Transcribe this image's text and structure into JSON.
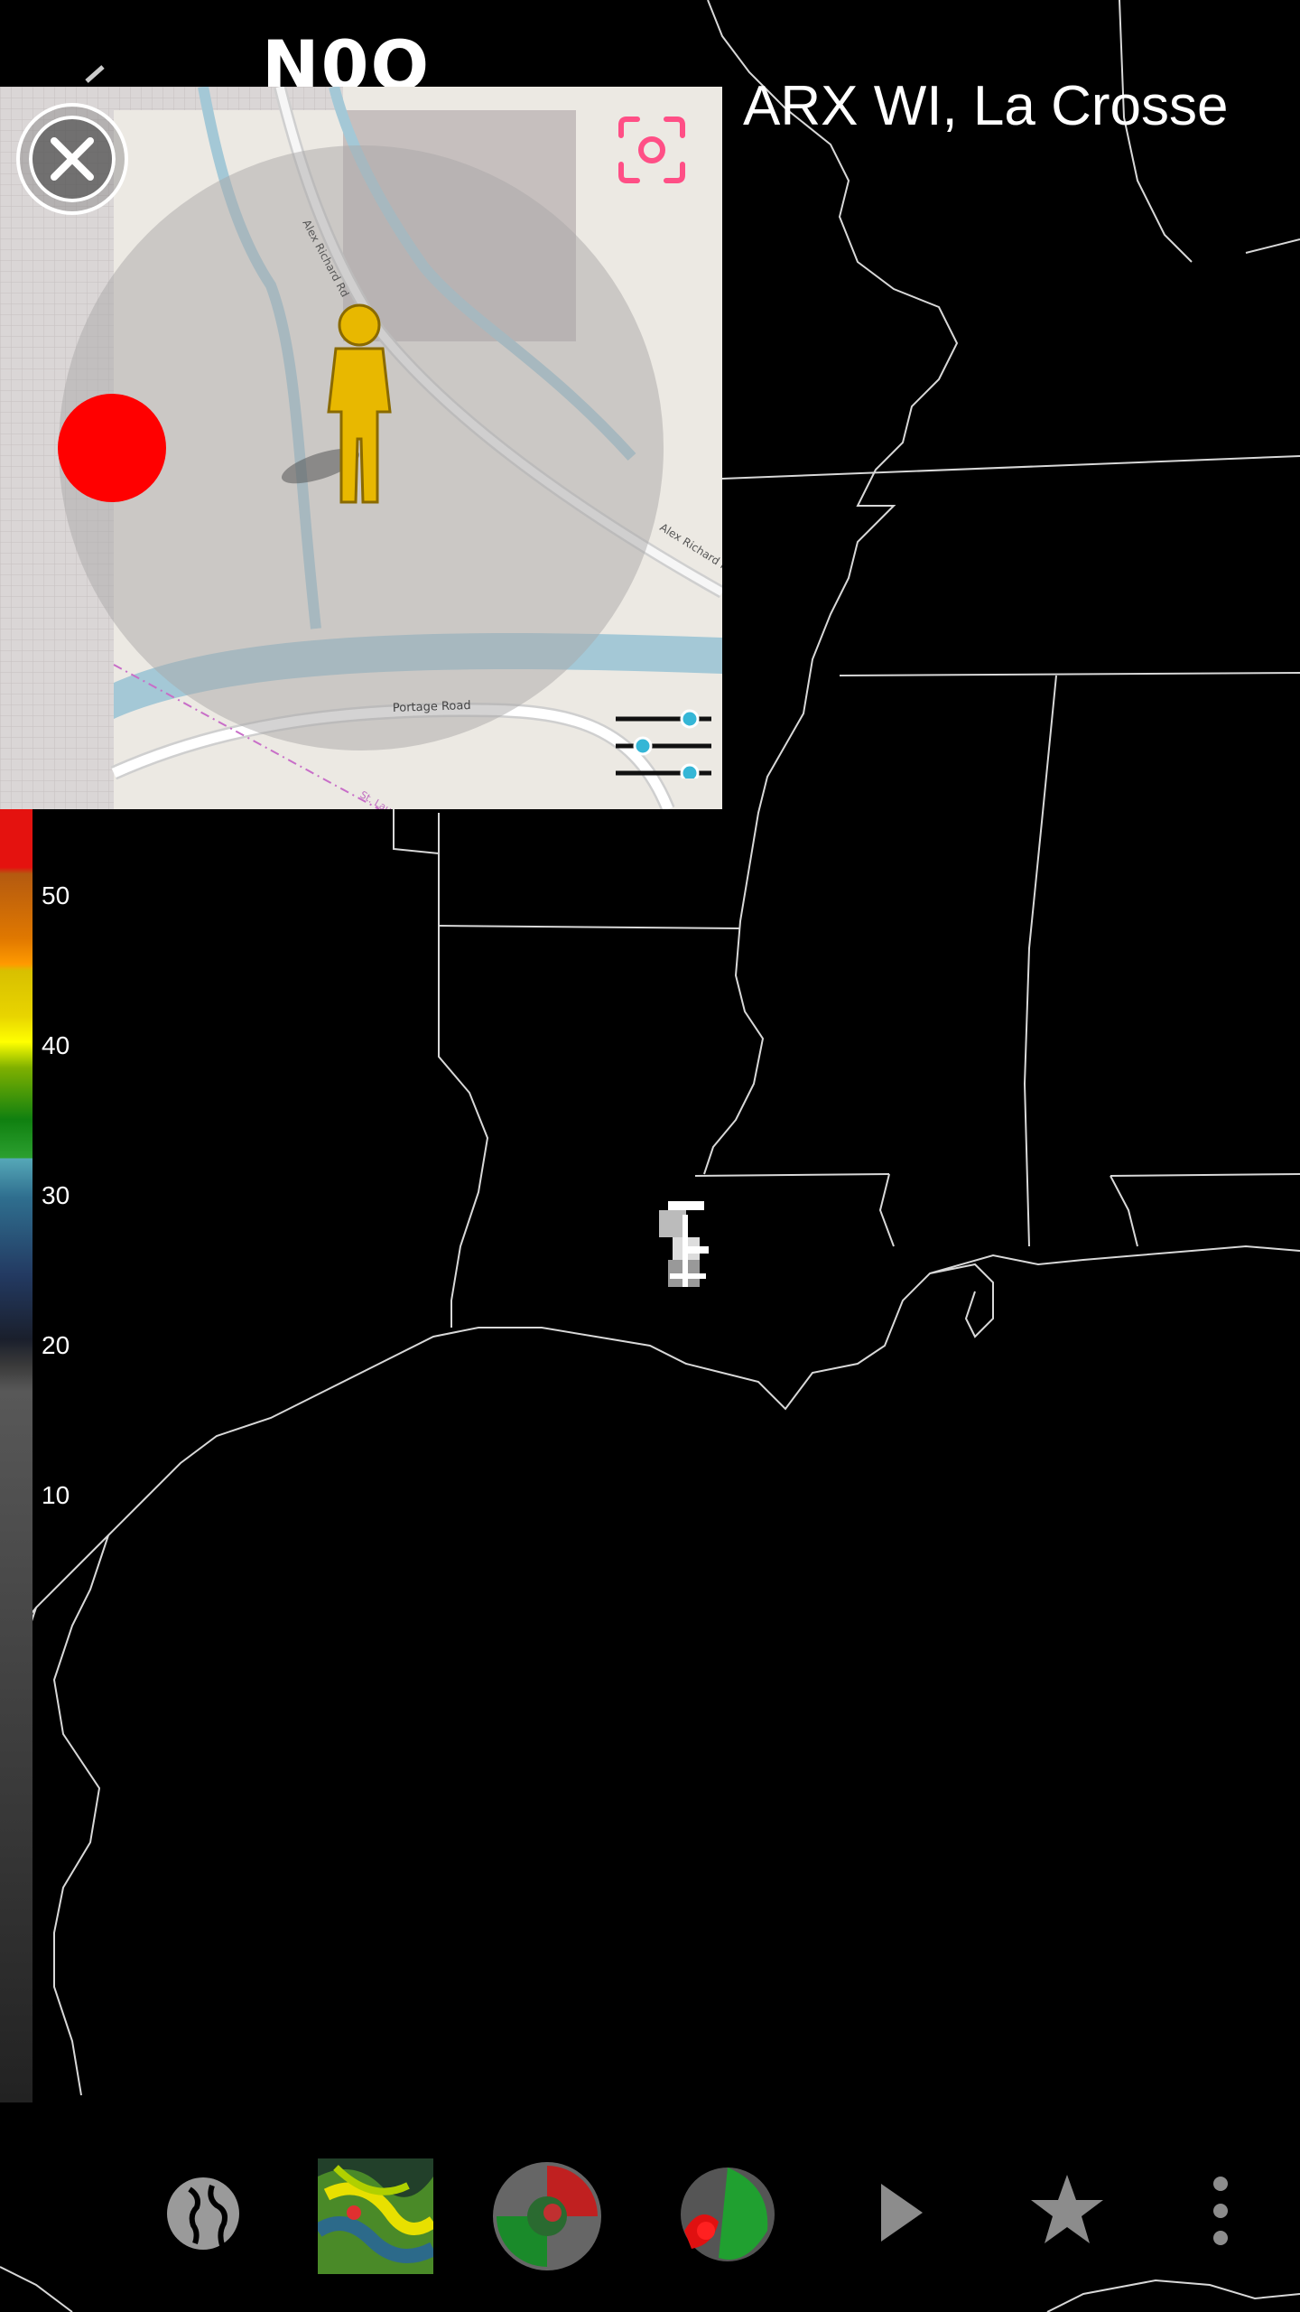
{
  "header": {
    "product_code": "N0Q",
    "station": "ARX WI, La Crosse"
  },
  "overlay_map": {
    "roads": [
      "Alex Richard Rd",
      "Alex Richard Rd",
      "Portage Road",
      "St. Lau"
    ]
  },
  "legend": {
    "labels": [
      "50",
      "40",
      "30",
      "20",
      "10"
    ],
    "colors": [
      "#e4120f",
      "#c86410",
      "#ff9a00",
      "#e8d400",
      "#ffff00",
      "#7fb000",
      "#108010",
      "#2ca030",
      "#56a8b8",
      "#2f6f8f",
      "#233a62",
      "#1a1f2c",
      "#585858",
      "#2a2a2a"
    ]
  },
  "toolbar": {
    "items": [
      "globe-icon",
      "radar-thumb-composite",
      "radar-thumb-velocity",
      "radar-thumb-storm",
      "play-icon",
      "star-icon",
      "more-icon"
    ]
  },
  "colors": {
    "accent": "#ff4f86",
    "slider_knob": "#35b6d6",
    "map_water": "#a4c8d6",
    "map_land": "#e8e5df"
  }
}
